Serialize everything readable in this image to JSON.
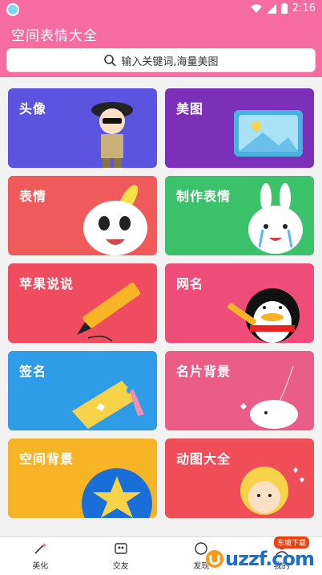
{
  "status_bar": {
    "time": "2:16"
  },
  "app": {
    "title": "空间表情大全"
  },
  "search": {
    "placeholder": "输入关键词,海量美图"
  },
  "categories": [
    {
      "label": "头像",
      "color": "#5b54e0"
    },
    {
      "label": "美图",
      "color": "#7c2fb8"
    },
    {
      "label": "表情",
      "color": "#f05a5a"
    },
    {
      "label": "制作表情",
      "color": "#3cc26a"
    },
    {
      "label": "苹果说说",
      "color": "#ef4d5f"
    },
    {
      "label": "网名",
      "color": "#ef4d79"
    },
    {
      "label": "签名",
      "color": "#2f9ce8"
    },
    {
      "label": "名片背景",
      "color": "#ea5d88"
    },
    {
      "label": "空间背景",
      "color": "#f7b426"
    },
    {
      "label": "动图大全",
      "color": "#ef4d57"
    }
  ],
  "bottom_nav": [
    {
      "label": "美化",
      "icon": "magic-wand-icon"
    },
    {
      "label": "交友",
      "icon": "friends-icon"
    },
    {
      "label": "发现",
      "icon": "discover-icon"
    },
    {
      "label": "我的",
      "icon": "profile-icon"
    }
  ],
  "watermark": {
    "text": "uzzf.com",
    "tag": "东坡下载"
  }
}
